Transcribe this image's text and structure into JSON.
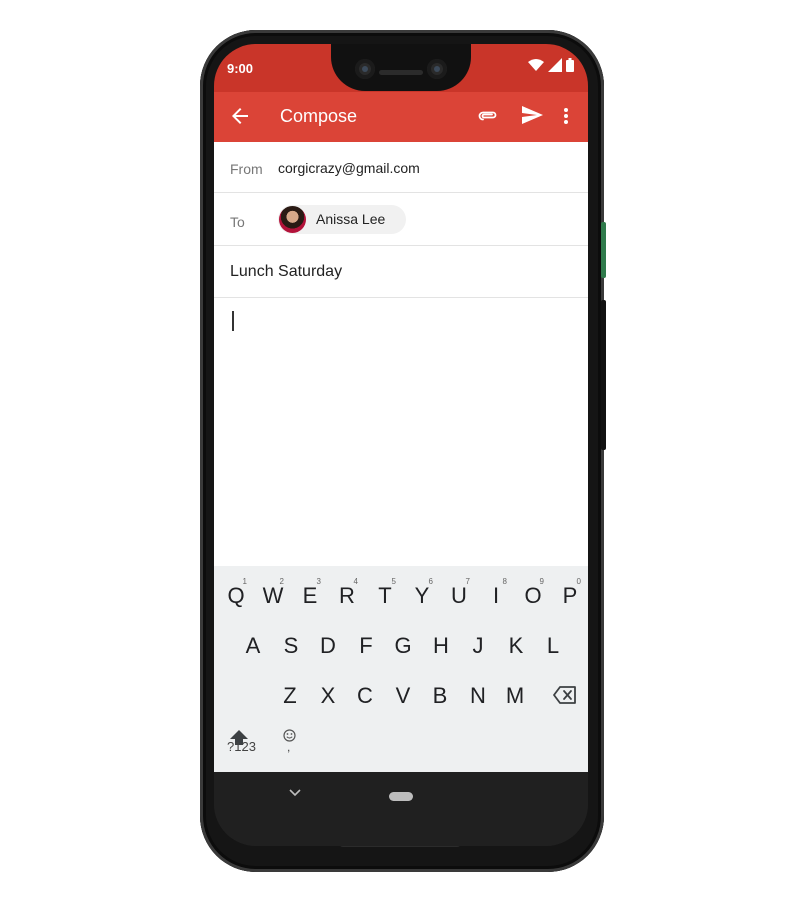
{
  "status_bar": {
    "time": "9:00"
  },
  "app_bar": {
    "title": "Compose",
    "icons": [
      "back-arrow-icon",
      "paperclip-icon",
      "send-icon",
      "more-vert-icon"
    ]
  },
  "compose": {
    "from_label": "From",
    "from_value": "corgicrazy@gmail.com",
    "to_label": "To",
    "recipients": [
      {
        "name": "Anissa Lee"
      }
    ],
    "subject": "Lunch Saturday",
    "body": ""
  },
  "keyboard": {
    "row1": [
      {
        "key": "Q",
        "hint": "1"
      },
      {
        "key": "W",
        "hint": "2"
      },
      {
        "key": "E",
        "hint": "3"
      },
      {
        "key": "R",
        "hint": "4"
      },
      {
        "key": "T",
        "hint": "5"
      },
      {
        "key": "Y",
        "hint": "6"
      },
      {
        "key": "U",
        "hint": "7"
      },
      {
        "key": "I",
        "hint": "8"
      },
      {
        "key": "O",
        "hint": "9"
      },
      {
        "key": "P",
        "hint": "0"
      }
    ],
    "row2": [
      "A",
      "S",
      "D",
      "F",
      "G",
      "H",
      "J",
      "K",
      "L"
    ],
    "row3": [
      "Z",
      "X",
      "C",
      "V",
      "B",
      "N",
      "M"
    ],
    "symbols_label": "?123",
    "emoji_comma_label": ",",
    "period_label": "."
  },
  "colors": {
    "app_bar": "#db4437",
    "status_bar": "#c93529",
    "enter_key": "#4285f4"
  }
}
